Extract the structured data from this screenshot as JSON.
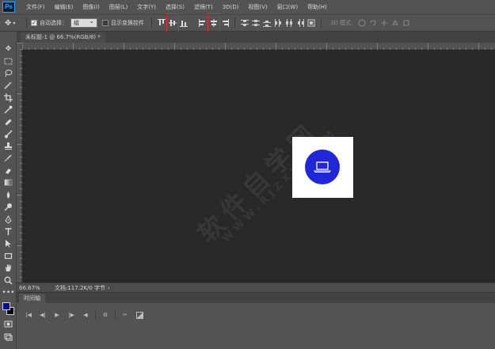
{
  "app": {
    "logo": "Ps"
  },
  "menubar": {
    "items": [
      "文件(F)",
      "编辑(E)",
      "图像(I)",
      "图层(L)",
      "文字(Y)",
      "选择(S)",
      "滤镜(T)",
      "3D(D)",
      "视图(V)",
      "窗口(W)",
      "帮助(H)"
    ]
  },
  "options": {
    "auto_select_checked": "✓",
    "auto_select_label": "自动选择：",
    "auto_select_target": "组",
    "show_transform_label": "显示变换控件",
    "mode_3d_label": "3D 模式："
  },
  "document": {
    "tab_title": "未标题-1 @ 66.7%(RGB/8) *",
    "zoom": "66.67%",
    "doc_info": "文档:117.2K/0 字节"
  },
  "timeline": {
    "tab_label": "时间轴"
  },
  "watermark": {
    "text_cn": "软件自学网",
    "text_url": "WWW.RJZXW.COM"
  },
  "colors": {
    "highlight": "#e5272b",
    "circle": "#1f27d8",
    "foreground": "#0a0a8c",
    "background": "#000000"
  },
  "icons": {
    "tools": [
      "move-icon",
      "marquee-icon",
      "lasso-icon",
      "magic-wand-icon",
      "crop-icon",
      "eyedropper-icon",
      "healing-brush-icon",
      "brush-icon",
      "clone-stamp-icon",
      "history-brush-icon",
      "eraser-icon",
      "gradient-icon",
      "blur-icon",
      "dodge-icon",
      "pen-icon",
      "type-icon",
      "path-selection-icon",
      "rectangle-icon",
      "hand-icon",
      "zoom-icon",
      "more-icon"
    ],
    "artboard_symbol": "laptop-icon"
  }
}
